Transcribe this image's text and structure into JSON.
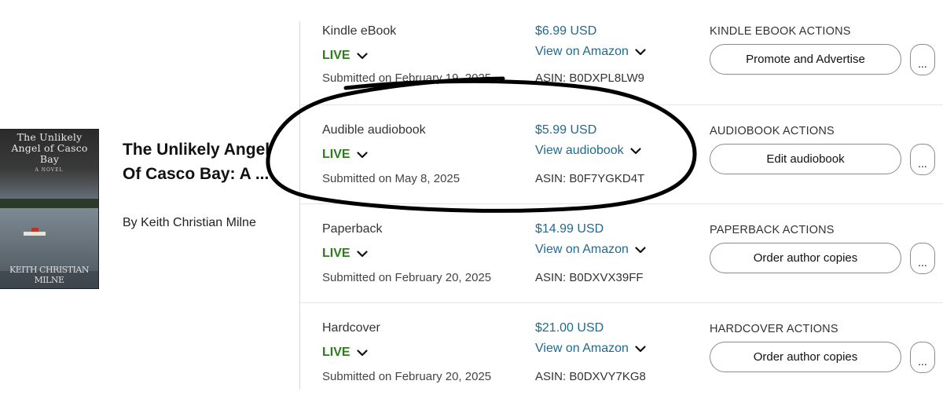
{
  "book": {
    "title": "The Unlikely Angel Of Casco Bay: A ...",
    "author": "By Keith Christian Milne",
    "cover": {
      "title": "The Unlikely Angel of Casco Bay",
      "subtitle": "A NOVEL",
      "author": "KEITH CHRISTIAN MILNE"
    }
  },
  "formats": [
    {
      "name": "Kindle eBook",
      "status": "LIVE",
      "submitted": "Submitted on February 19, 2025",
      "price": "$6.99 USD",
      "link": "View on Amazon",
      "asin": "ASIN: B0DXPL8LW9",
      "actions_label": "KINDLE EBOOK ACTIONS",
      "action_button": "Promote and Advertise",
      "more": "..."
    },
    {
      "name": "Audible audiobook",
      "status": "LIVE",
      "submitted": "Submitted on May 8, 2025",
      "price": "$5.99 USD",
      "link": "View audiobook",
      "asin": "ASIN: B0F7YGKD4T",
      "actions_label": "AUDIOBOOK ACTIONS",
      "action_button": "Edit audiobook",
      "more": "..."
    },
    {
      "name": "Paperback",
      "status": "LIVE",
      "submitted": "Submitted on February 20, 2025",
      "price": "$14.99 USD",
      "link": "View on Amazon",
      "asin": "ASIN: B0DXVX39FF",
      "actions_label": "PAPERBACK ACTIONS",
      "action_button": "Order author copies",
      "more": "..."
    },
    {
      "name": "Hardcover",
      "status": "LIVE",
      "submitted": "Submitted on February 20, 2025",
      "price": "$21.00 USD",
      "link": "View on Amazon",
      "asin": "ASIN: B0DXVY7KG8",
      "actions_label": "HARDCOVER ACTIONS",
      "action_button": "Order author copies",
      "more": "..."
    }
  ],
  "colors": {
    "live_green": "#2f7a21",
    "link_blue": "#1f6a8f",
    "annotation_ink": "#000000"
  }
}
